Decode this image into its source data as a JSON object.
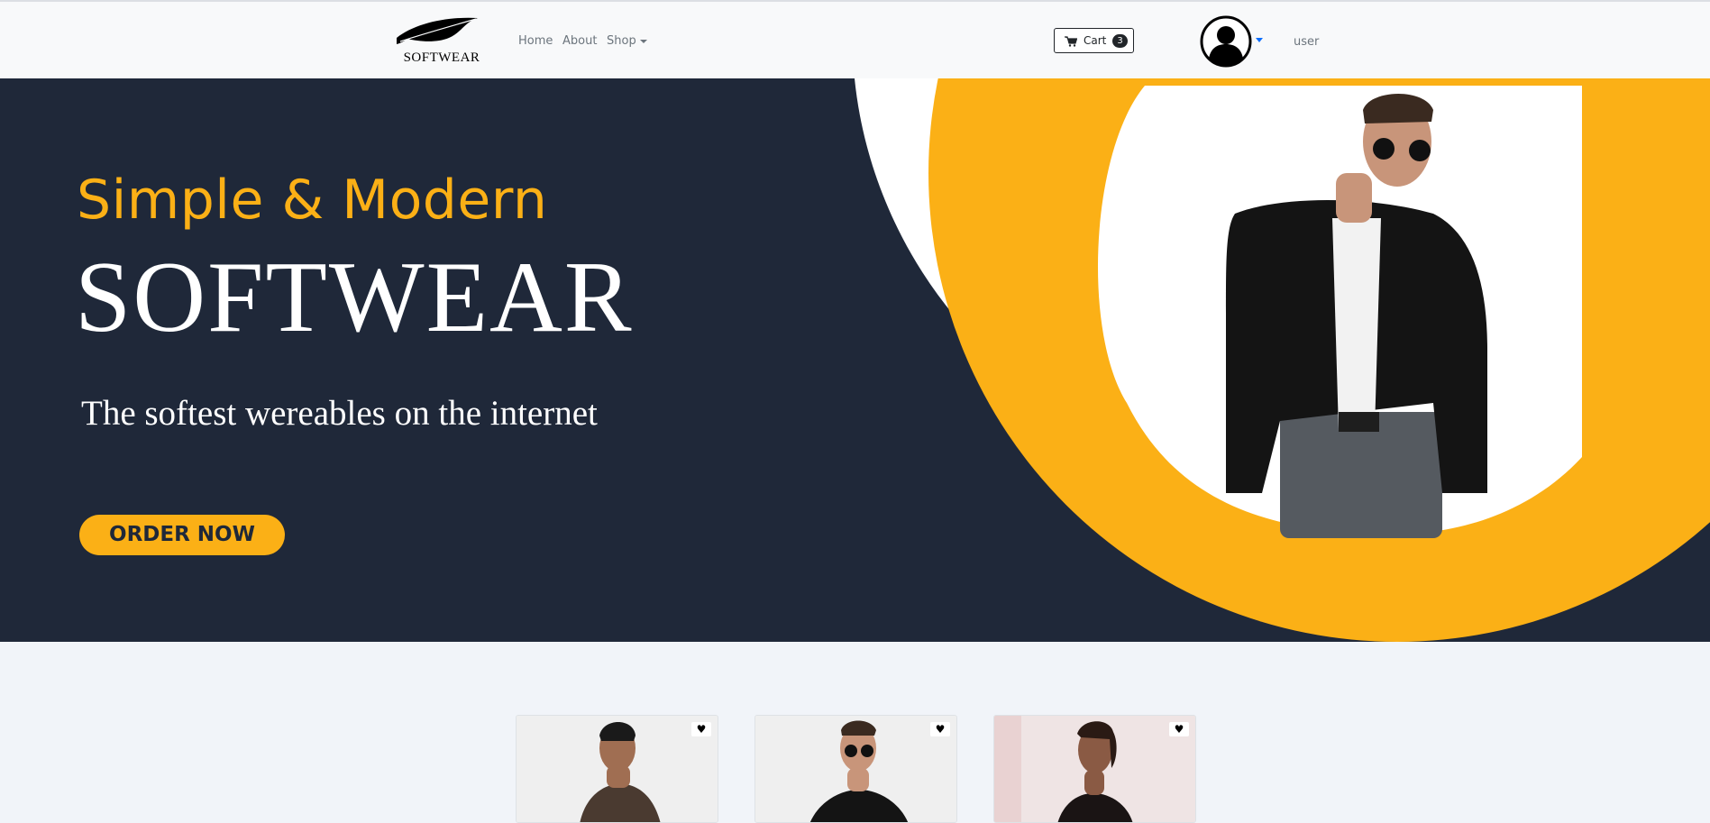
{
  "brand": {
    "logo_text": "SOFTWEAR"
  },
  "nav": {
    "home": "Home",
    "about": "About",
    "shop": "Shop",
    "cart_label": "Cart",
    "cart_count": "3",
    "user_label": "user"
  },
  "hero": {
    "tagline": "Simple & Modern",
    "brand_name": "SOFTWEAR",
    "subtitle": "The softest wereables on the internet",
    "cta": "ORDER NOW"
  },
  "products": [
    {
      "favorite_icon": "heart-icon",
      "symbol": "♥"
    },
    {
      "favorite_icon": "heart-icon",
      "symbol": "♥"
    },
    {
      "favorite_icon": "heart-icon",
      "symbol": "♥"
    }
  ],
  "colors": {
    "accent": "#fbb016",
    "hero_background": "#1f2839",
    "navbar_background": "#f8f9fa",
    "page_background": "#f1f4f9"
  }
}
